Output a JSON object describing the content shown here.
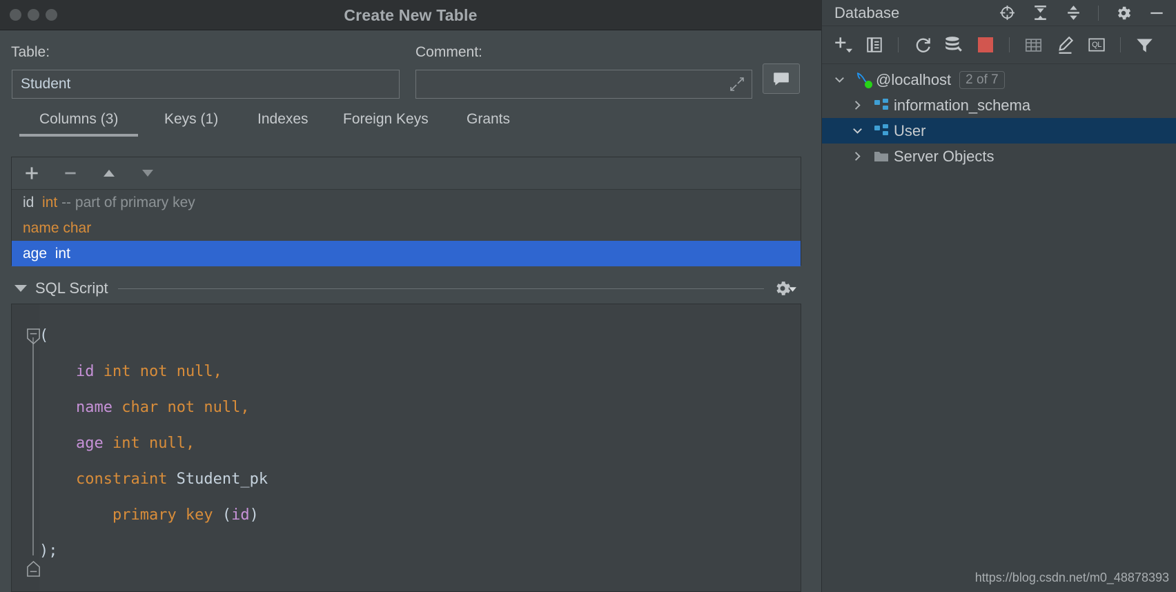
{
  "dialog": {
    "title": "Create New Table",
    "window_controls": [
      "close",
      "minimize",
      "maximize"
    ],
    "table_label": "Table:",
    "table_value": "Student",
    "comment_label": "Comment:",
    "comment_value": "",
    "comment_placeholder": "",
    "expand_icon": "expand-arrows-icon",
    "comment_button_icon": "comment-bubble-icon",
    "tabs": [
      {
        "label": "Columns (3)",
        "active": true
      },
      {
        "label": "Keys (1)",
        "active": false
      },
      {
        "label": "Indexes",
        "active": false
      },
      {
        "label": "Foreign Keys",
        "active": false
      },
      {
        "label": "Grants",
        "active": false
      }
    ],
    "columns_toolbar": [
      {
        "name": "add-column-button",
        "glyph": "+"
      },
      {
        "name": "remove-column-button",
        "glyph": "−"
      },
      {
        "name": "move-up-button",
        "glyph": "▲"
      },
      {
        "name": "move-down-button",
        "glyph": "▼"
      }
    ],
    "columns": [
      {
        "name": "id",
        "type": "int",
        "comment": "-- part of primary key",
        "selected": false,
        "name_style": "plain"
      },
      {
        "name": "name",
        "type": "char",
        "comment": "",
        "selected": false,
        "name_style": "type"
      },
      {
        "name": "age",
        "type": "int",
        "comment": "",
        "selected": true,
        "name_style": "plain"
      }
    ],
    "sql_section": {
      "label": "SQL Script",
      "expanded": true,
      "settings_icon": "gear-dropdown-icon"
    },
    "sql_lines": [
      [
        {
          "t": "(",
          "c": "p"
        }
      ],
      [
        {
          "t": "    ",
          "c": "p"
        },
        {
          "t": "id",
          "c": "v"
        },
        {
          "t": " ",
          "c": "p"
        },
        {
          "t": "int not null,",
          "c": "k"
        }
      ],
      [
        {
          "t": "    ",
          "c": "p"
        },
        {
          "t": "name",
          "c": "v"
        },
        {
          "t": " ",
          "c": "p"
        },
        {
          "t": "char not null,",
          "c": "k"
        }
      ],
      [
        {
          "t": "    ",
          "c": "p"
        },
        {
          "t": "age",
          "c": "v"
        },
        {
          "t": " ",
          "c": "p"
        },
        {
          "t": "int null,",
          "c": "k"
        }
      ],
      [
        {
          "t": "    ",
          "c": "p"
        },
        {
          "t": "constraint",
          "c": "k"
        },
        {
          "t": " Student_pk",
          "c": "p"
        }
      ],
      [
        {
          "t": "        ",
          "c": "p"
        },
        {
          "t": "primary key",
          "c": "k"
        },
        {
          "t": " (",
          "c": "p"
        },
        {
          "t": "id",
          "c": "v"
        },
        {
          "t": ")",
          "c": "p"
        }
      ],
      [
        {
          "t": ");",
          "c": "p"
        }
      ]
    ]
  },
  "database_panel": {
    "title": "Database",
    "header_icons": [
      "scroll-from-source-icon",
      "expand-all-icon",
      "collapse-all-icon",
      "gear-icon",
      "hide-icon"
    ],
    "toolbar_icons": [
      "add-new-icon",
      "duplicate-icon",
      "refresh-icon",
      "datasource-properties-icon",
      "stop-icon",
      "table-editor-icon",
      "modify-icon",
      "query-console-icon",
      "filter-icon"
    ],
    "tree": [
      {
        "label": "@localhost",
        "icon": "mysql-dolphin-icon",
        "expanded": true,
        "indent": 0,
        "badge": "2 of 7",
        "selected": false,
        "status": "connected"
      },
      {
        "label": "information_schema",
        "icon": "schema-icon",
        "expanded": false,
        "indent": 1,
        "badge": "",
        "selected": false
      },
      {
        "label": "User",
        "icon": "schema-icon",
        "expanded": true,
        "indent": 1,
        "badge": "",
        "selected": true
      },
      {
        "label": "Server Objects",
        "icon": "folder-icon",
        "expanded": false,
        "indent": 1,
        "badge": "",
        "selected": false
      }
    ]
  },
  "watermark": "https://blog.csdn.net/m0_48878393",
  "colors": {
    "accent_selection": "#2f66d0",
    "keyword": "#d98d3a",
    "identifier": "#c792d8",
    "tree_selected": "#10385c",
    "stop_red": "#d2564f",
    "status_green": "#27d317",
    "schema_blue": "#3f9fd4"
  }
}
